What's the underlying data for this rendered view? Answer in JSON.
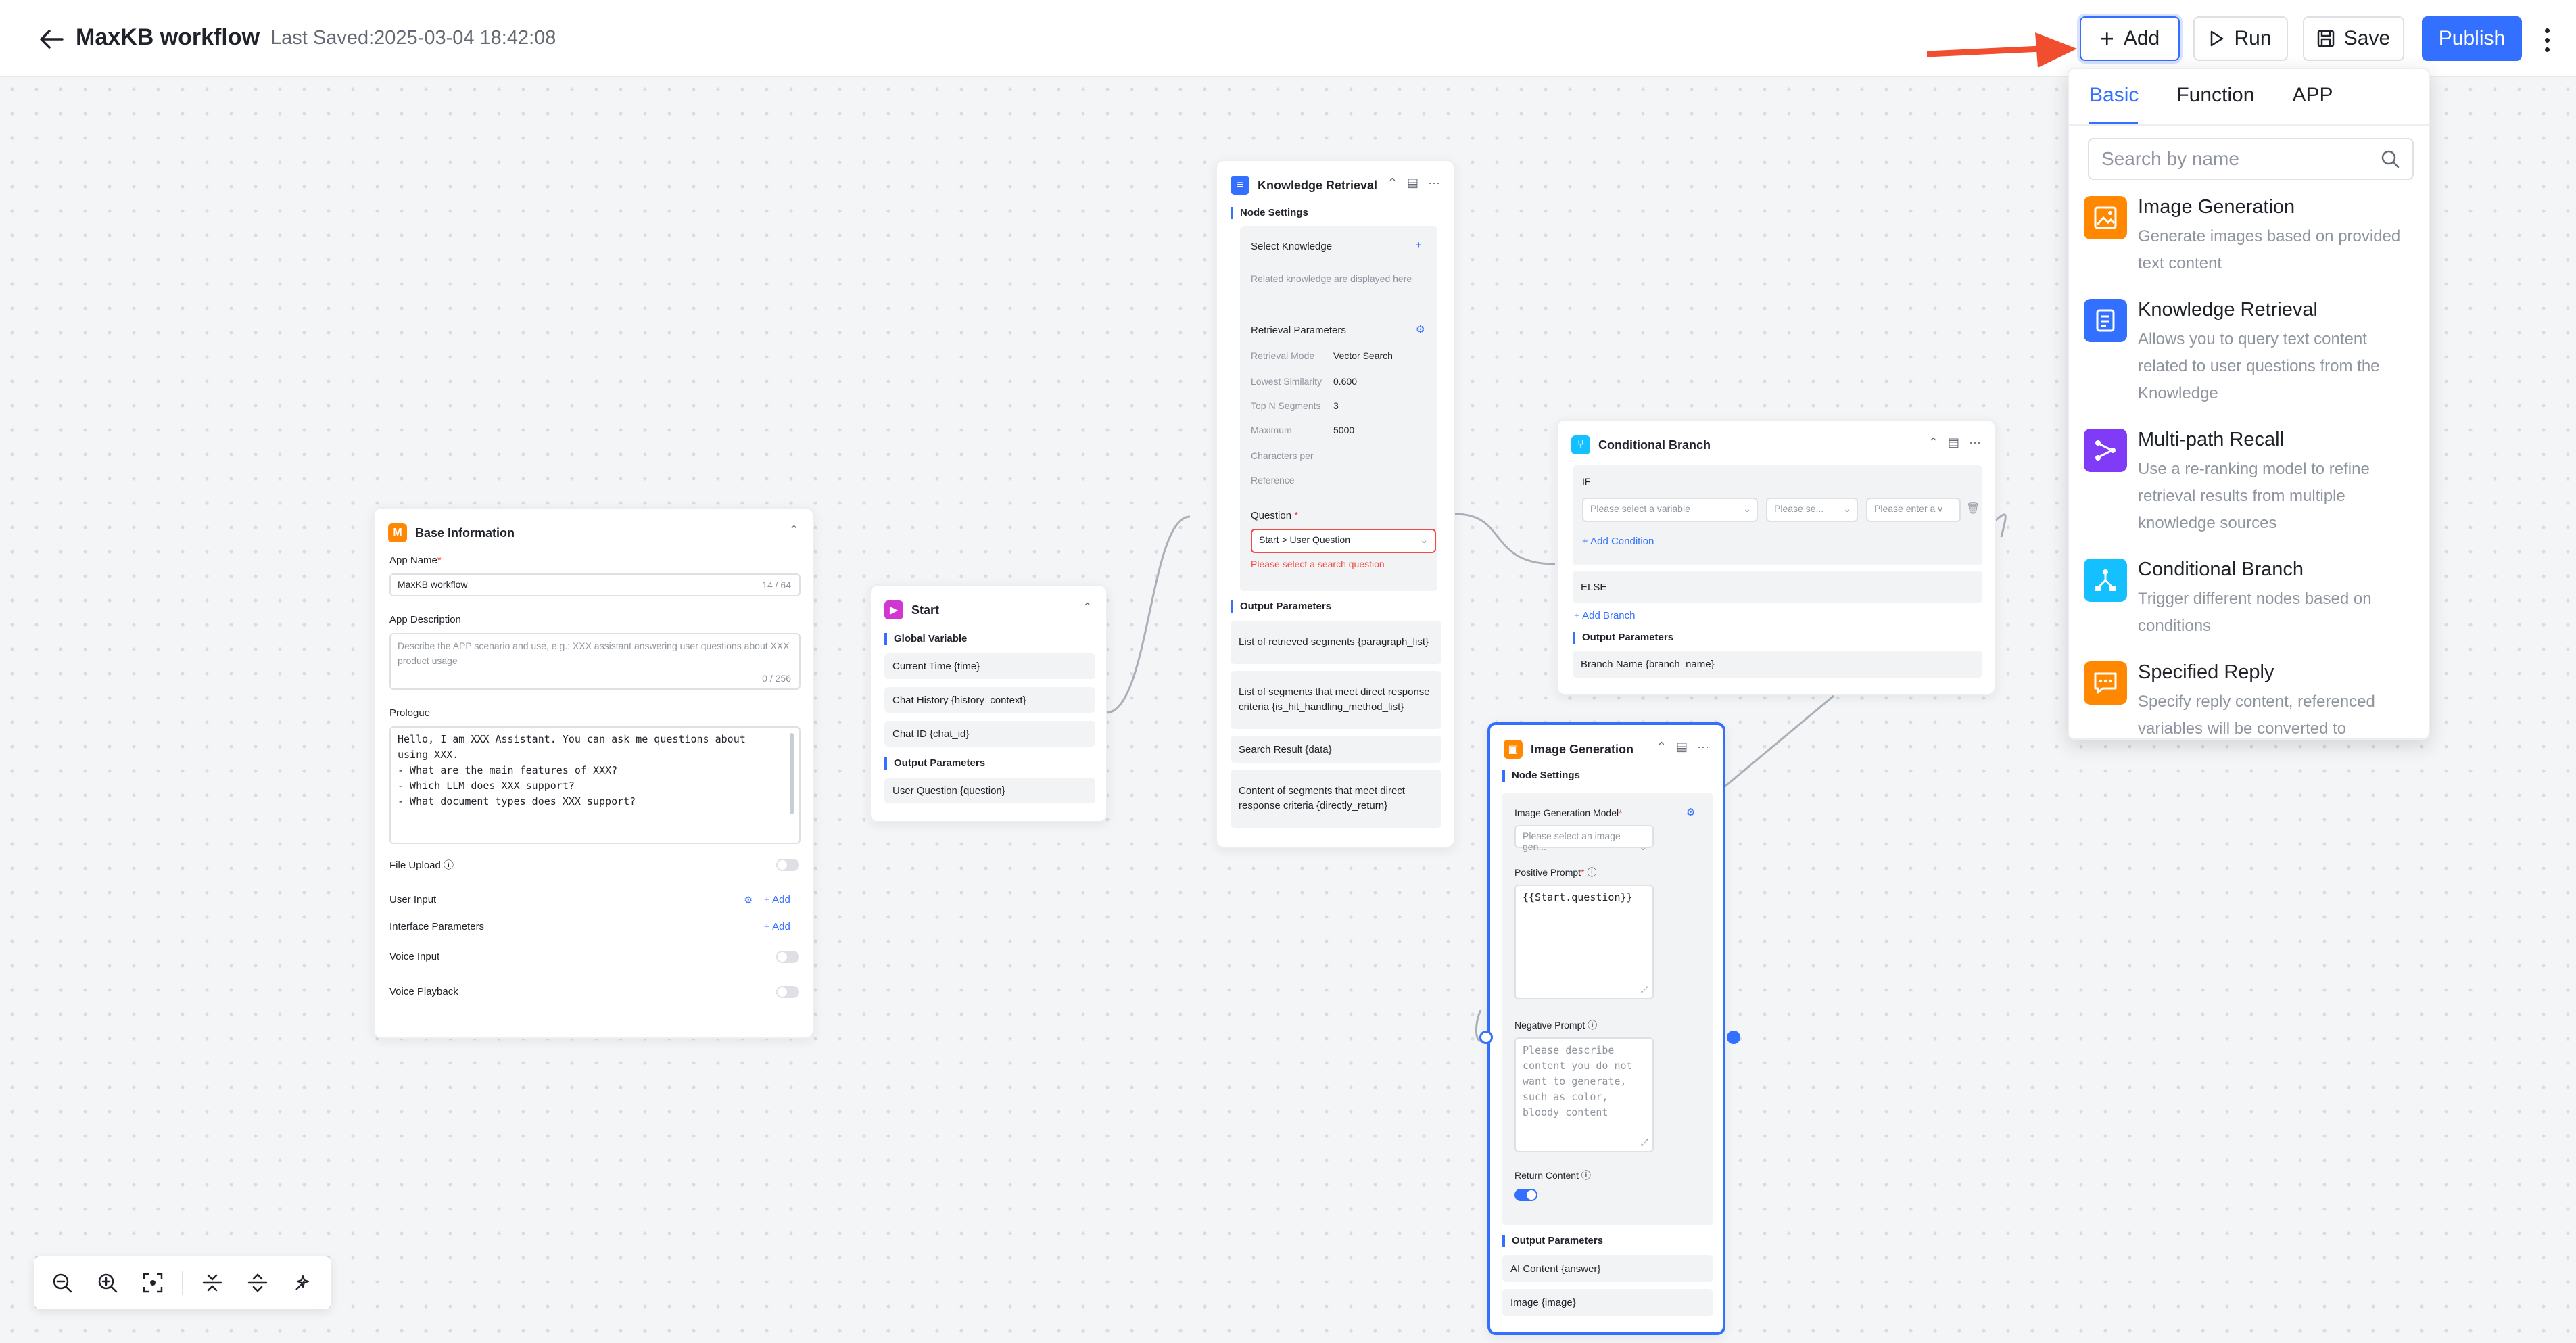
{
  "header": {
    "title": "MaxKB workflow",
    "last_saved": "Last Saved:2025-03-04 18:42:08",
    "buttons": {
      "add": "Add",
      "run": "Run",
      "save": "Save",
      "publish": "Publish"
    }
  },
  "add_panel": {
    "tabs": [
      "Basic",
      "Function",
      "APP"
    ],
    "search_placeholder": "Search by name",
    "items": [
      {
        "title": "Image Generation",
        "desc": "Generate images based on provided text content"
      },
      {
        "title": "Knowledge Retrieval",
        "desc": "Allows you to query text content related to user questions from the Knowledge"
      },
      {
        "title": "Multi-path Recall",
        "desc": "Use a re-ranking model to refine retrieval results from multiple knowledge sources"
      },
      {
        "title": "Conditional Branch",
        "desc": "Trigger different nodes based on conditions"
      },
      {
        "title": "Specified Reply",
        "desc": "Specify reply content, referenced variables will be converted to"
      }
    ]
  },
  "base_info": {
    "title": "Base Information",
    "app_name_label": "App Name",
    "app_name_value": "MaxKB workflow",
    "app_name_count": "14 / 64",
    "app_desc_label": "App Description",
    "app_desc_placeholder": "Describe the APP scenario and use, e.g.: XXX assistant answering user questions about XXX product usage",
    "app_desc_count": "0 / 256",
    "prologue_label": "Prologue",
    "prologue_value": "Hello, I am XXX Assistant. You can ask me questions about\nusing XXX.\n- What are the main features of XXX?\n- Which LLM does XXX support?\n- What document types does XXX support?",
    "file_upload_label": "File Upload",
    "user_input_label": "User Input",
    "interface_params_label": "Interface Parameters",
    "voice_input_label": "Voice Input",
    "voice_playback_label": "Voice Playback",
    "add_link": "Add"
  },
  "start": {
    "title": "Start",
    "global_var_label": "Global Variable",
    "global_vars": [
      "Current Time {time}",
      "Chat History {history_context}",
      "Chat ID {chat_id}"
    ],
    "output_label": "Output Parameters",
    "outputs": [
      "User Question {question}"
    ]
  },
  "knowledge": {
    "title": "Knowledge Retrieval",
    "node_settings": "Node Settings",
    "select_knowledge": "Select Knowledge",
    "related_hint": "Related knowledge are displayed here",
    "retrieval_params": "Retrieval Parameters",
    "params": [
      {
        "k": "Retrieval Mode",
        "v": "Vector Search"
      },
      {
        "k": "Lowest Similarity",
        "v": "0.600"
      },
      {
        "k": "Top N Segments",
        "v": "3"
      },
      {
        "k": "Maximum",
        "v": "5000"
      },
      {
        "k": "Characters per",
        "v": ""
      },
      {
        "k": "Reference",
        "v": ""
      }
    ],
    "question_label": "Question",
    "question_value": "Start > User Question",
    "question_error": "Please select a search question",
    "output_label": "Output Parameters",
    "outputs": [
      "List of retrieved segments {paragraph_list}",
      "List of segments that meet direct response criteria {is_hit_handling_method_list}",
      "Search Result {data}",
      "Content of segments that meet direct response criteria {directly_return}"
    ]
  },
  "condition": {
    "title": "Conditional Branch",
    "if_label": "IF",
    "var_placeholder": "Please select a variable",
    "op_placeholder": "Please se...",
    "val_placeholder": "Please enter a v",
    "add_condition": "Add Condition",
    "else_label": "ELSE",
    "add_branch": "Add Branch",
    "output_label": "Output Parameters",
    "outputs": [
      "Branch Name {branch_name}"
    ]
  },
  "image_gen": {
    "title": "Image Generation",
    "node_settings": "Node Settings",
    "model_label": "Image Generation Model",
    "model_placeholder": "Please select an image gen...",
    "positive_label": "Positive Prompt",
    "positive_value": "{{Start.question}}",
    "negative_label": "Negative Prompt",
    "negative_placeholder": "Please describe content you do not want to generate, such as color, bloody content",
    "return_label": "Return Content",
    "output_label": "Output Parameters",
    "outputs": [
      "AI Content {answer}",
      "Image {image}"
    ]
  },
  "colors": {
    "accent": "#3370ff",
    "arrow": "#f04e2e",
    "orange": "#ff8800",
    "blue": "#3370ff",
    "purple": "#7f3bf5",
    "cyan": "#14c0ff",
    "pink": "#d136d1"
  }
}
